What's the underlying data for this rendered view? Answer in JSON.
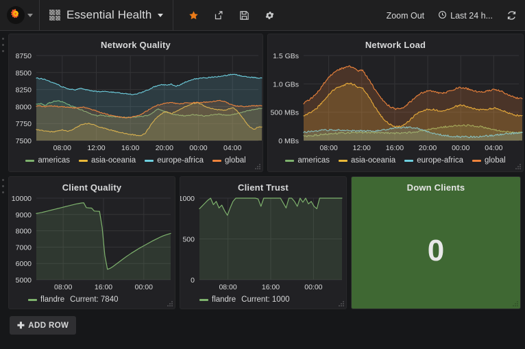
{
  "nav": {
    "logo_icon": "grafana-logo-icon",
    "logo_caret_icon": "chevron-down-icon",
    "dashboard_grid_icon": "dashboard-grid-icon",
    "dashboard_title": "Essential Health",
    "title_caret_icon": "chevron-down-icon",
    "icons": [
      {
        "name": "star-icon",
        "title": "Mark as favorite"
      },
      {
        "name": "share-icon",
        "title": "Share dashboard"
      },
      {
        "name": "save-icon",
        "title": "Save dashboard"
      },
      {
        "name": "gear-icon",
        "title": "Dashboard settings"
      }
    ],
    "zoom_out_label": "Zoom Out",
    "clock_icon": "clock-icon",
    "time_range_label": "Last 24 h...",
    "refresh_icon": "refresh-icon"
  },
  "footer": {
    "add_row_label": "ADD ROW",
    "add_row_plus_icon": "plus-icon"
  },
  "colors": {
    "americas": "#7EB26D",
    "asia_oceania": "#EAB839",
    "europe_africa": "#6ED0E0",
    "global": "#EF843C",
    "flandre": "#7EB26D",
    "singlestat_green": "#3F6833",
    "panel_bg": "#212124",
    "page_bg": "#161719",
    "nav_bg": "#1F1F20",
    "grid_line": "#3a3a3c",
    "text": "#D8D9DA"
  },
  "panels": [
    {
      "title": "Network Quality"
    },
    {
      "title": "Network Load"
    },
    {
      "title": "Client Quality"
    },
    {
      "title": "Client Trust"
    },
    {
      "title": "Down Clients"
    }
  ],
  "singlestat": {
    "title": "Down Clients",
    "value": "0"
  },
  "chart_data": [
    {
      "id": "network-quality",
      "type": "line",
      "title": "Network Quality",
      "xlabel": "",
      "ylabel": "",
      "ylim": [
        7500,
        8750
      ],
      "yticks": [
        7500,
        7750,
        8000,
        8250,
        8500,
        8750
      ],
      "ytick_labels": [
        "7500",
        "7750",
        "8000",
        "8250",
        "8500",
        "8750"
      ],
      "xticks": [
        "08:00",
        "12:00",
        "16:00",
        "20:00",
        "00:00",
        "04:00"
      ],
      "grid": true,
      "legend_position": "bottom",
      "fill": true,
      "series": [
        {
          "name": "americas",
          "color": "#7EB26D",
          "values": [
            8030,
            8045,
            8020,
            8055,
            8075,
            8085,
            8070,
            8040,
            8010,
            7985,
            7960,
            7935,
            7905,
            7880,
            7865,
            7875,
            7860,
            7855,
            7850,
            7845,
            7840,
            7838,
            7842,
            7848,
            7855,
            7862,
            7880,
            7925,
            7965,
            7940,
            7915,
            7895,
            7880,
            7872,
            7866,
            7872,
            7880,
            7876,
            7868,
            7860,
            7875,
            7890,
            7886,
            7878,
            7872,
            7880,
            7895,
            7912,
            7928,
            7944,
            7958,
            7968
          ]
        },
        {
          "name": "asia-oceania",
          "color": "#EAB839",
          "values": [
            7665,
            7650,
            7640,
            7632,
            7628,
            7648,
            7660,
            7635,
            7645,
            7688,
            7720,
            7745,
            7752,
            7735,
            7712,
            7690,
            7672,
            7655,
            7640,
            7625,
            7612,
            7596,
            7588,
            7578,
            7572,
            7608,
            7700,
            7790,
            7860,
            7905,
            7930,
            7895,
            7930,
            7960,
            7990,
            8020,
            8045,
            8055,
            8030,
            7995,
            7975,
            7960,
            7950,
            7945,
            7960,
            7985,
            7945,
            7870,
            7780,
            7700,
            7665,
            7700
          ]
        },
        {
          "name": "europe-africa",
          "color": "#6ED0E0",
          "values": [
            8420,
            8410,
            8398,
            8372,
            8345,
            8318,
            8290,
            8268,
            8252,
            8246,
            8268,
            8255,
            8240,
            8228,
            8220,
            8218,
            8222,
            8215,
            8208,
            8200,
            8192,
            8185,
            8175,
            8188,
            8205,
            8228,
            8255,
            8288,
            8310,
            8322,
            8318,
            8330,
            8298,
            8320,
            8352,
            8382,
            8400,
            8412,
            8418,
            8422,
            8430,
            8438,
            8442,
            8450,
            8462,
            8478,
            8468,
            8452,
            8440,
            8432,
            8428,
            8418
          ]
        },
        {
          "name": "global",
          "color": "#EF843C",
          "values": [
            8010,
            8006,
            8000,
            8012,
            8008,
            8000,
            7998,
            7992,
            7985,
            7978,
            7985,
            7990,
            7975,
            7952,
            7930,
            7908,
            7890,
            7872,
            7858,
            7848,
            7842,
            7838,
            7845,
            7862,
            7885,
            7920,
            7960,
            7995,
            8022,
            8040,
            8052,
            8060,
            8048,
            8042,
            8050,
            8055,
            8058,
            8060,
            8062,
            8065,
            8070,
            8080,
            8090,
            8078,
            8050,
            8022,
            8008,
            8005,
            8002,
            8008,
            8012,
            8015
          ]
        }
      ]
    },
    {
      "id": "network-load",
      "type": "area",
      "title": "Network Load",
      "xlabel": "",
      "ylabel": "",
      "ylim": [
        0,
        1500
      ],
      "yticks": [
        0,
        500,
        1000,
        1500
      ],
      "ytick_labels": [
        "0 MBs",
        "500 MBs",
        "1.0 GBs",
        "1.5 GBs"
      ],
      "xticks": [
        "08:00",
        "12:00",
        "16:00",
        "20:00",
        "00:00",
        "04:00"
      ],
      "unit": "MBs",
      "grid": true,
      "legend_position": "bottom",
      "fill": true,
      "series": [
        {
          "name": "americas",
          "color": "#7EB26D",
          "values": [
            75,
            82,
            90,
            96,
            103,
            110,
            116,
            122,
            128,
            132,
            135,
            138,
            140,
            142,
            143,
            143,
            142,
            140,
            138,
            136,
            134,
            132,
            132,
            133,
            136,
            142,
            150,
            160,
            172,
            186,
            200,
            214,
            226,
            238,
            248,
            256,
            262,
            266,
            268,
            268,
            264,
            256,
            244,
            228,
            210,
            192,
            176,
            164,
            155,
            148,
            142,
            138
          ]
        },
        {
          "name": "asia-oceania",
          "color": "#EAB839",
          "values": [
            440,
            470,
            510,
            560,
            640,
            730,
            820,
            880,
            930,
            960,
            990,
            1010,
            985,
            930,
            930,
            820,
            700,
            580,
            470,
            380,
            310,
            265,
            240,
            250,
            290,
            350,
            420,
            480,
            520,
            545,
            555,
            545,
            530,
            525,
            540,
            570,
            600,
            620,
            615,
            595,
            570,
            550,
            540,
            545,
            560,
            570,
            560,
            535,
            505,
            475,
            450,
            440
          ]
        },
        {
          "name": "europe-africa",
          "color": "#6ED0E0",
          "values": [
            148,
            155,
            162,
            170,
            178,
            182,
            186,
            188,
            186,
            182,
            178,
            175,
            172,
            170,
            169,
            168,
            168,
            170,
            176,
            186,
            198,
            212,
            224,
            232,
            236,
            234,
            226,
            212,
            192,
            168,
            145,
            125,
            108,
            95,
            85,
            78,
            72,
            68,
            66,
            65,
            66,
            68,
            72,
            78,
            86,
            95,
            104,
            112,
            120,
            126,
            132,
            136
          ]
        },
        {
          "name": "global",
          "color": "#EF843C",
          "values": [
            660,
            700,
            760,
            830,
            920,
            1030,
            1120,
            1190,
            1240,
            1270,
            1295,
            1310,
            1285,
            1230,
            1240,
            1130,
            1010,
            890,
            780,
            690,
            625,
            580,
            555,
            565,
            605,
            665,
            730,
            790,
            840,
            868,
            878,
            862,
            845,
            840,
            855,
            885,
            915,
            935,
            930,
            910,
            888,
            868,
            858,
            862,
            880,
            900,
            890,
            865,
            830,
            790,
            760,
            750
          ]
        }
      ]
    },
    {
      "id": "client-quality",
      "type": "area",
      "title": "Client Quality",
      "xlabel": "",
      "ylabel": "",
      "ylim": [
        5000,
        10000
      ],
      "yticks": [
        5000,
        6000,
        7000,
        8000,
        9000,
        10000
      ],
      "ytick_labels": [
        "5000",
        "6000",
        "7000",
        "8000",
        "9000",
        "10000"
      ],
      "xticks": [
        "08:00",
        "16:00",
        "00:00"
      ],
      "grid": true,
      "legend_position": "bottom-left",
      "fill": true,
      "legend_current_label": "Current: 7840",
      "series": [
        {
          "name": "flandre",
          "color": "#7EB26D",
          "values": [
            9060,
            9090,
            9120,
            9160,
            9200,
            9240,
            9280,
            9320,
            9360,
            9400,
            9440,
            9480,
            9520,
            9560,
            9600,
            9640,
            9670,
            9700,
            9715,
            9420,
            9400,
            9390,
            9210,
            9200,
            9190,
            8200,
            6500,
            5640,
            5700,
            5800,
            5920,
            6040,
            6160,
            6280,
            6400,
            6510,
            6620,
            6720,
            6820,
            6920,
            7010,
            7100,
            7190,
            7280,
            7370,
            7450,
            7530,
            7610,
            7680,
            7740,
            7790,
            7840
          ]
        }
      ]
    },
    {
      "id": "client-trust",
      "type": "area",
      "title": "Client Trust",
      "xlabel": "",
      "ylabel": "",
      "ylim": [
        0,
        1000
      ],
      "yticks": [
        0,
        500,
        1000
      ],
      "ytick_labels": [
        "0",
        "500",
        "1000"
      ],
      "xticks": [
        "08:00",
        "16:00",
        "00:00"
      ],
      "grid": true,
      "legend_position": "bottom-left",
      "fill": true,
      "legend_current_label": "Current: 1000",
      "series": [
        {
          "name": "flandre",
          "color": "#7EB26D",
          "values": [
            870,
            905,
            940,
            975,
            1000,
            920,
            960,
            880,
            915,
            845,
            790,
            880,
            960,
            1000,
            1000,
            1000,
            1000,
            1000,
            1000,
            1000,
            1000,
            990,
            900,
            1000,
            1000,
            1000,
            1000,
            1000,
            1000,
            1000,
            940,
            880,
            1000,
            1000,
            960,
            900,
            1000,
            950,
            1000,
            930,
            960,
            900,
            870,
            1000,
            1000,
            1000,
            1000,
            1000,
            1000,
            1000,
            1000,
            1000
          ]
        }
      ]
    }
  ]
}
